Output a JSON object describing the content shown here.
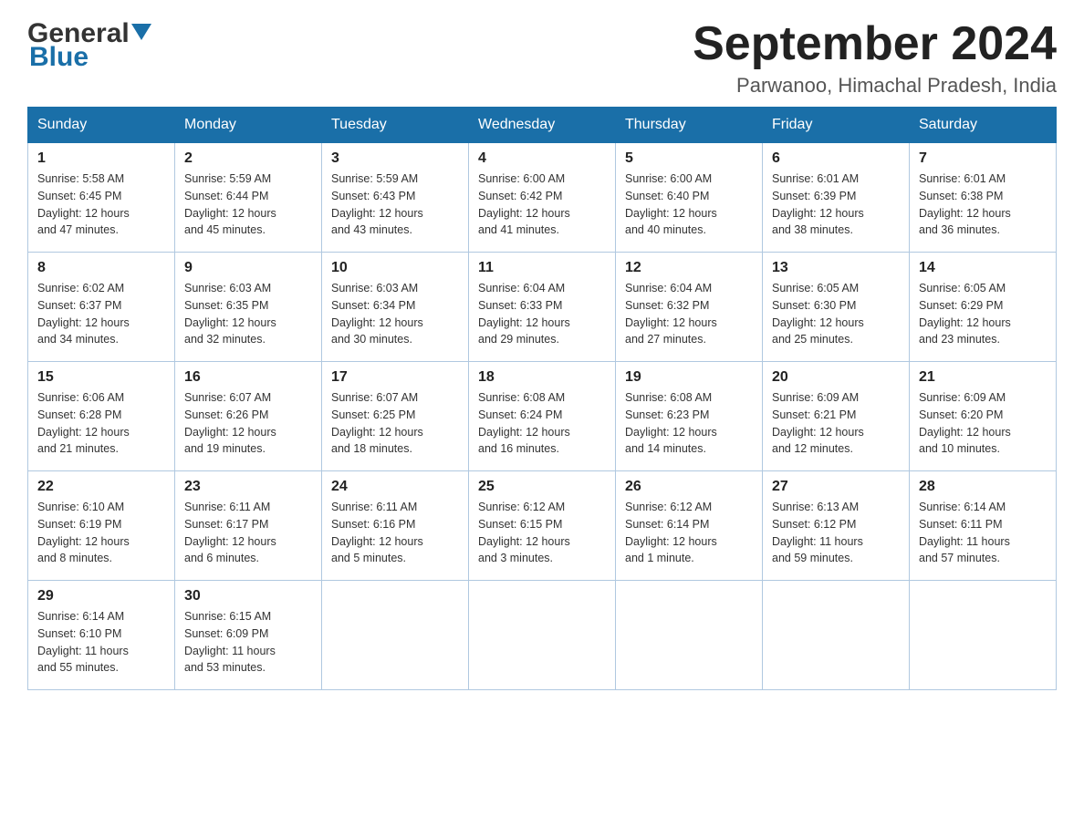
{
  "header": {
    "logo_general": "General",
    "logo_blue": "Blue",
    "month_title": "September 2024",
    "location": "Parwanoo, Himachal Pradesh, India"
  },
  "weekdays": [
    "Sunday",
    "Monday",
    "Tuesday",
    "Wednesday",
    "Thursday",
    "Friday",
    "Saturday"
  ],
  "weeks": [
    [
      {
        "day": "1",
        "sunrise": "5:58 AM",
        "sunset": "6:45 PM",
        "daylight": "12 hours and 47 minutes."
      },
      {
        "day": "2",
        "sunrise": "5:59 AM",
        "sunset": "6:44 PM",
        "daylight": "12 hours and 45 minutes."
      },
      {
        "day": "3",
        "sunrise": "5:59 AM",
        "sunset": "6:43 PM",
        "daylight": "12 hours and 43 minutes."
      },
      {
        "day": "4",
        "sunrise": "6:00 AM",
        "sunset": "6:42 PM",
        "daylight": "12 hours and 41 minutes."
      },
      {
        "day": "5",
        "sunrise": "6:00 AM",
        "sunset": "6:40 PM",
        "daylight": "12 hours and 40 minutes."
      },
      {
        "day": "6",
        "sunrise": "6:01 AM",
        "sunset": "6:39 PM",
        "daylight": "12 hours and 38 minutes."
      },
      {
        "day": "7",
        "sunrise": "6:01 AM",
        "sunset": "6:38 PM",
        "daylight": "12 hours and 36 minutes."
      }
    ],
    [
      {
        "day": "8",
        "sunrise": "6:02 AM",
        "sunset": "6:37 PM",
        "daylight": "12 hours and 34 minutes."
      },
      {
        "day": "9",
        "sunrise": "6:03 AM",
        "sunset": "6:35 PM",
        "daylight": "12 hours and 32 minutes."
      },
      {
        "day": "10",
        "sunrise": "6:03 AM",
        "sunset": "6:34 PM",
        "daylight": "12 hours and 30 minutes."
      },
      {
        "day": "11",
        "sunrise": "6:04 AM",
        "sunset": "6:33 PM",
        "daylight": "12 hours and 29 minutes."
      },
      {
        "day": "12",
        "sunrise": "6:04 AM",
        "sunset": "6:32 PM",
        "daylight": "12 hours and 27 minutes."
      },
      {
        "day": "13",
        "sunrise": "6:05 AM",
        "sunset": "6:30 PM",
        "daylight": "12 hours and 25 minutes."
      },
      {
        "day": "14",
        "sunrise": "6:05 AM",
        "sunset": "6:29 PM",
        "daylight": "12 hours and 23 minutes."
      }
    ],
    [
      {
        "day": "15",
        "sunrise": "6:06 AM",
        "sunset": "6:28 PM",
        "daylight": "12 hours and 21 minutes."
      },
      {
        "day": "16",
        "sunrise": "6:07 AM",
        "sunset": "6:26 PM",
        "daylight": "12 hours and 19 minutes."
      },
      {
        "day": "17",
        "sunrise": "6:07 AM",
        "sunset": "6:25 PM",
        "daylight": "12 hours and 18 minutes."
      },
      {
        "day": "18",
        "sunrise": "6:08 AM",
        "sunset": "6:24 PM",
        "daylight": "12 hours and 16 minutes."
      },
      {
        "day": "19",
        "sunrise": "6:08 AM",
        "sunset": "6:23 PM",
        "daylight": "12 hours and 14 minutes."
      },
      {
        "day": "20",
        "sunrise": "6:09 AM",
        "sunset": "6:21 PM",
        "daylight": "12 hours and 12 minutes."
      },
      {
        "day": "21",
        "sunrise": "6:09 AM",
        "sunset": "6:20 PM",
        "daylight": "12 hours and 10 minutes."
      }
    ],
    [
      {
        "day": "22",
        "sunrise": "6:10 AM",
        "sunset": "6:19 PM",
        "daylight": "12 hours and 8 minutes."
      },
      {
        "day": "23",
        "sunrise": "6:11 AM",
        "sunset": "6:17 PM",
        "daylight": "12 hours and 6 minutes."
      },
      {
        "day": "24",
        "sunrise": "6:11 AM",
        "sunset": "6:16 PM",
        "daylight": "12 hours and 5 minutes."
      },
      {
        "day": "25",
        "sunrise": "6:12 AM",
        "sunset": "6:15 PM",
        "daylight": "12 hours and 3 minutes."
      },
      {
        "day": "26",
        "sunrise": "6:12 AM",
        "sunset": "6:14 PM",
        "daylight": "12 hours and 1 minute."
      },
      {
        "day": "27",
        "sunrise": "6:13 AM",
        "sunset": "6:12 PM",
        "daylight": "11 hours and 59 minutes."
      },
      {
        "day": "28",
        "sunrise": "6:14 AM",
        "sunset": "6:11 PM",
        "daylight": "11 hours and 57 minutes."
      }
    ],
    [
      {
        "day": "29",
        "sunrise": "6:14 AM",
        "sunset": "6:10 PM",
        "daylight": "11 hours and 55 minutes."
      },
      {
        "day": "30",
        "sunrise": "6:15 AM",
        "sunset": "6:09 PM",
        "daylight": "11 hours and 53 minutes."
      },
      null,
      null,
      null,
      null,
      null
    ]
  ],
  "labels": {
    "sunrise": "Sunrise:",
    "sunset": "Sunset:",
    "daylight": "Daylight:"
  }
}
